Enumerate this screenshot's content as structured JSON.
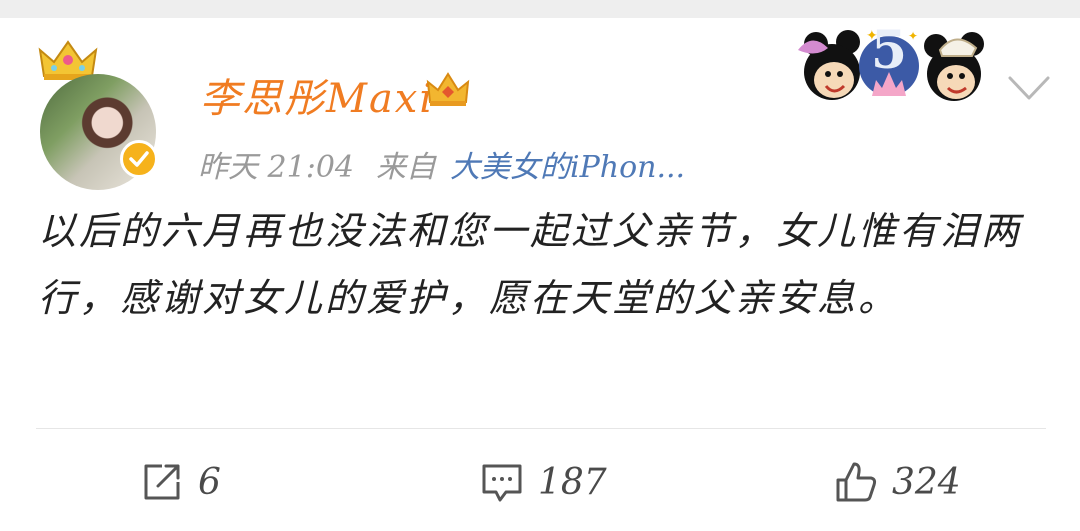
{
  "post": {
    "username": "李思彤Maxi",
    "time": "昨天 21:04",
    "source_prefix": "来自",
    "source_device": "大美女的iPhon...",
    "content": "以后的六月再也没法和您一起过父亲节，女儿惟有泪两行，感谢对女儿的爱护，愿在天堂的父亲安息。"
  },
  "actions": {
    "repost_count": "6",
    "comment_count": "187",
    "like_count": "324"
  },
  "icons": {
    "crown": "crown-icon",
    "verified": "verified-badge-icon",
    "vip": "vip-crown-icon",
    "badge": "disney-badge-icon",
    "menu": "chevron-down-icon",
    "repost": "repost-icon",
    "comment": "comment-icon",
    "like": "like-icon"
  },
  "colors": {
    "username": "#f07c22",
    "device": "#4f79b6",
    "verified": "#f6b21b"
  }
}
